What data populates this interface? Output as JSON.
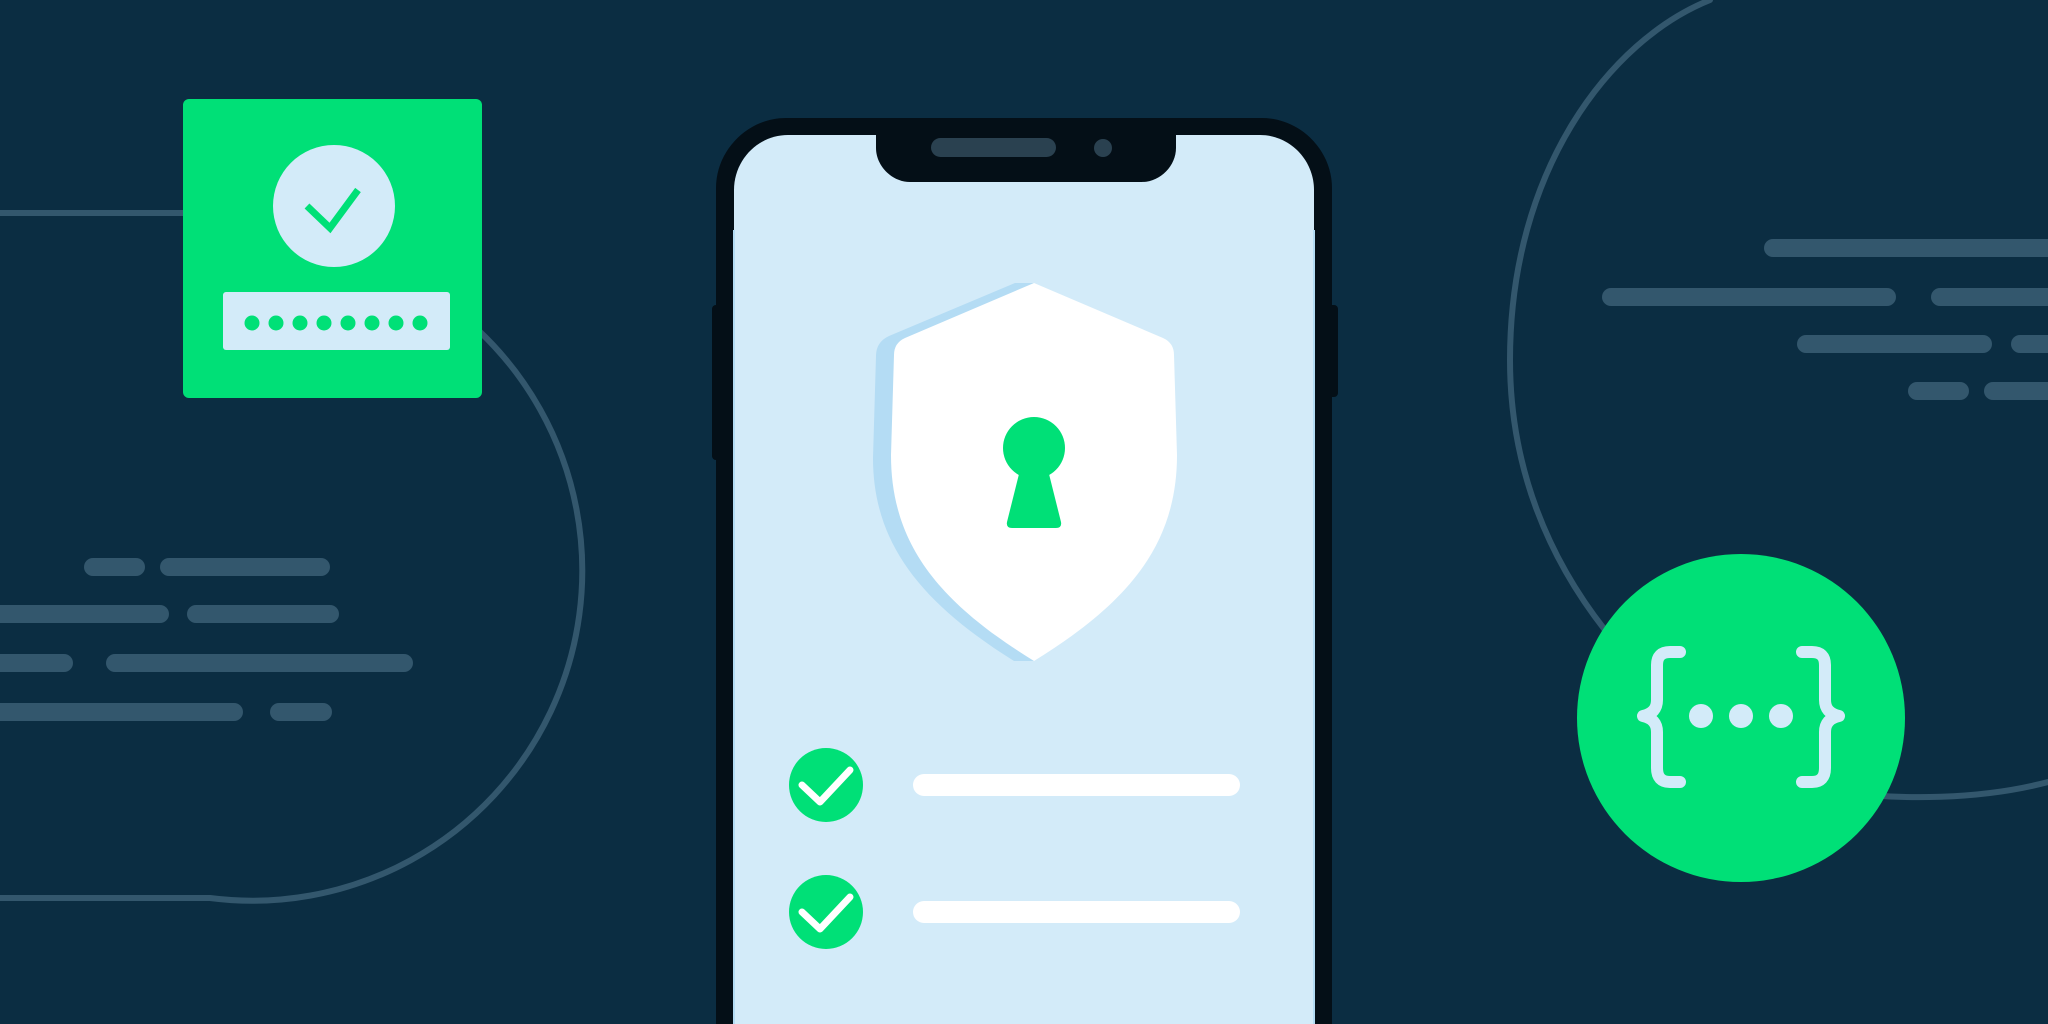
{
  "colors": {
    "background": "#0b2d42",
    "line": "#33576d",
    "accent_green": "#00e077",
    "phone_screen": "#d3ebf9",
    "phone_body": "#040f17",
    "shield_white": "#ffffff",
    "shield_shadow": "#b4dcf4",
    "tile_light": "#d3ebf9"
  },
  "icons": {
    "password_card": "password-check-icon",
    "shield": "shield-lock-icon",
    "keyhole": "keyhole-icon",
    "check": "checkmark-icon",
    "code": "curly-braces-icon"
  },
  "password_card": {
    "mask_dot_count": 8,
    "verified": true
  },
  "phone": {
    "checklist": [
      {
        "checked": true
      },
      {
        "checked": true
      }
    ]
  }
}
